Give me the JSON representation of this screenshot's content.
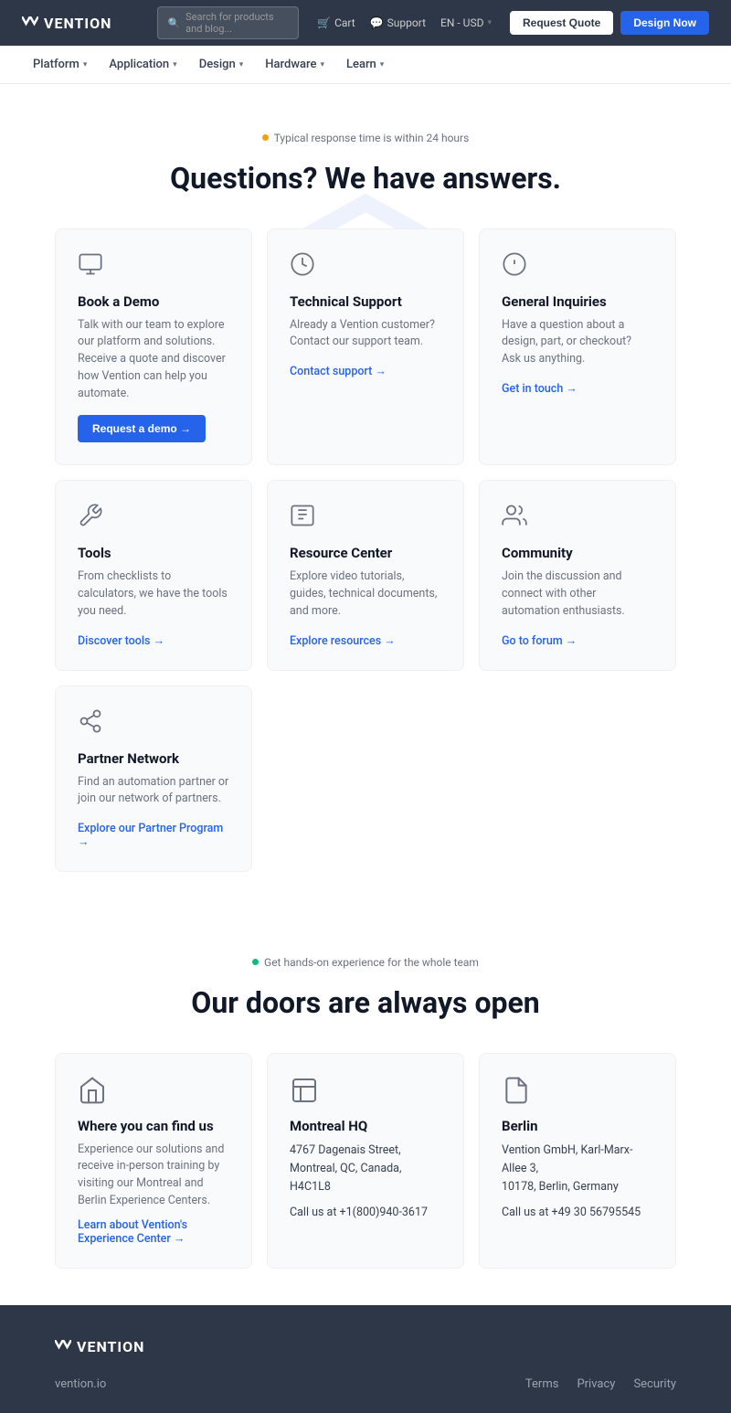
{
  "nav": {
    "logo": "VENTION",
    "search_placeholder": "Search for products and blog...",
    "cart_label": "Cart",
    "support_label": "Support",
    "lang_label": "EN - USD",
    "btn_quote": "Request Quote",
    "btn_design": "Design Now",
    "menu_items": [
      {
        "label": "Platform",
        "has_dropdown": true
      },
      {
        "label": "Application",
        "has_dropdown": true
      },
      {
        "label": "Design",
        "has_dropdown": true
      },
      {
        "label": "Hardware",
        "has_dropdown": true
      },
      {
        "label": "Learn",
        "has_dropdown": true
      }
    ]
  },
  "questions_section": {
    "badge": "Typical response time is within 24 hours",
    "title": "Questions? We have answers.",
    "cards": [
      {
        "id": "book-demo",
        "title": "Book a Demo",
        "desc": "Talk with our team to explore our platform and solutions. Receive a quote and discover how Vention can help you automate.",
        "cta": "Request a demo",
        "cta_type": "button"
      },
      {
        "id": "technical-support",
        "title": "Technical Support",
        "desc": "Already a Vention customer? Contact our support team.",
        "cta": "Contact support →",
        "cta_type": "link"
      },
      {
        "id": "general-inquiries",
        "title": "General Inquiries",
        "desc": "Have a question about a design, part, or checkout? Ask us anything.",
        "cta": "Get in touch →",
        "cta_type": "link"
      },
      {
        "id": "tools",
        "title": "Tools",
        "desc": "From checklists to calculators, we have the tools you need.",
        "cta": "Discover tools →",
        "cta_type": "link"
      },
      {
        "id": "resource-center",
        "title": "Resource Center",
        "desc": "Explore video tutorials, guides, technical documents, and more.",
        "cta": "Explore resources →",
        "cta_type": "link"
      },
      {
        "id": "community",
        "title": "Community",
        "desc": "Join the discussion and connect with other automation enthusiasts.",
        "cta": "Go to forum →",
        "cta_type": "link"
      },
      {
        "id": "partner-network",
        "title": "Partner Network",
        "desc": "Find an automation partner or join our network of partners.",
        "cta": "Explore our Partner Program →",
        "cta_type": "link"
      }
    ]
  },
  "doors_section": {
    "badge": "Get hands-on experience for the whole team",
    "title": "Our doors are always open",
    "locations": [
      {
        "id": "find-us",
        "title": "Where you can find us",
        "desc": "Experience our solutions and receive in-person training by visiting our Montreal and Berlin Experience Centers.",
        "cta": "Learn about Vention's Experience Center →"
      },
      {
        "id": "montreal",
        "title": "Montreal HQ",
        "address": "4767 Dagenais Street,\nMontreal, QC, Canada, H4C1L8",
        "phone": "Call us at +1(800)940-3617"
      },
      {
        "id": "berlin",
        "title": "Berlin",
        "address": "Vention GmbH, Karl-Marx-Allee 3,\n10178, Berlin, Germany",
        "phone": "Call us at +49 30 56795545"
      }
    ]
  },
  "footer": {
    "logo": "VENTION",
    "site_link": "vention.io",
    "legal_links": [
      "Terms",
      "Privacy",
      "Security"
    ]
  }
}
